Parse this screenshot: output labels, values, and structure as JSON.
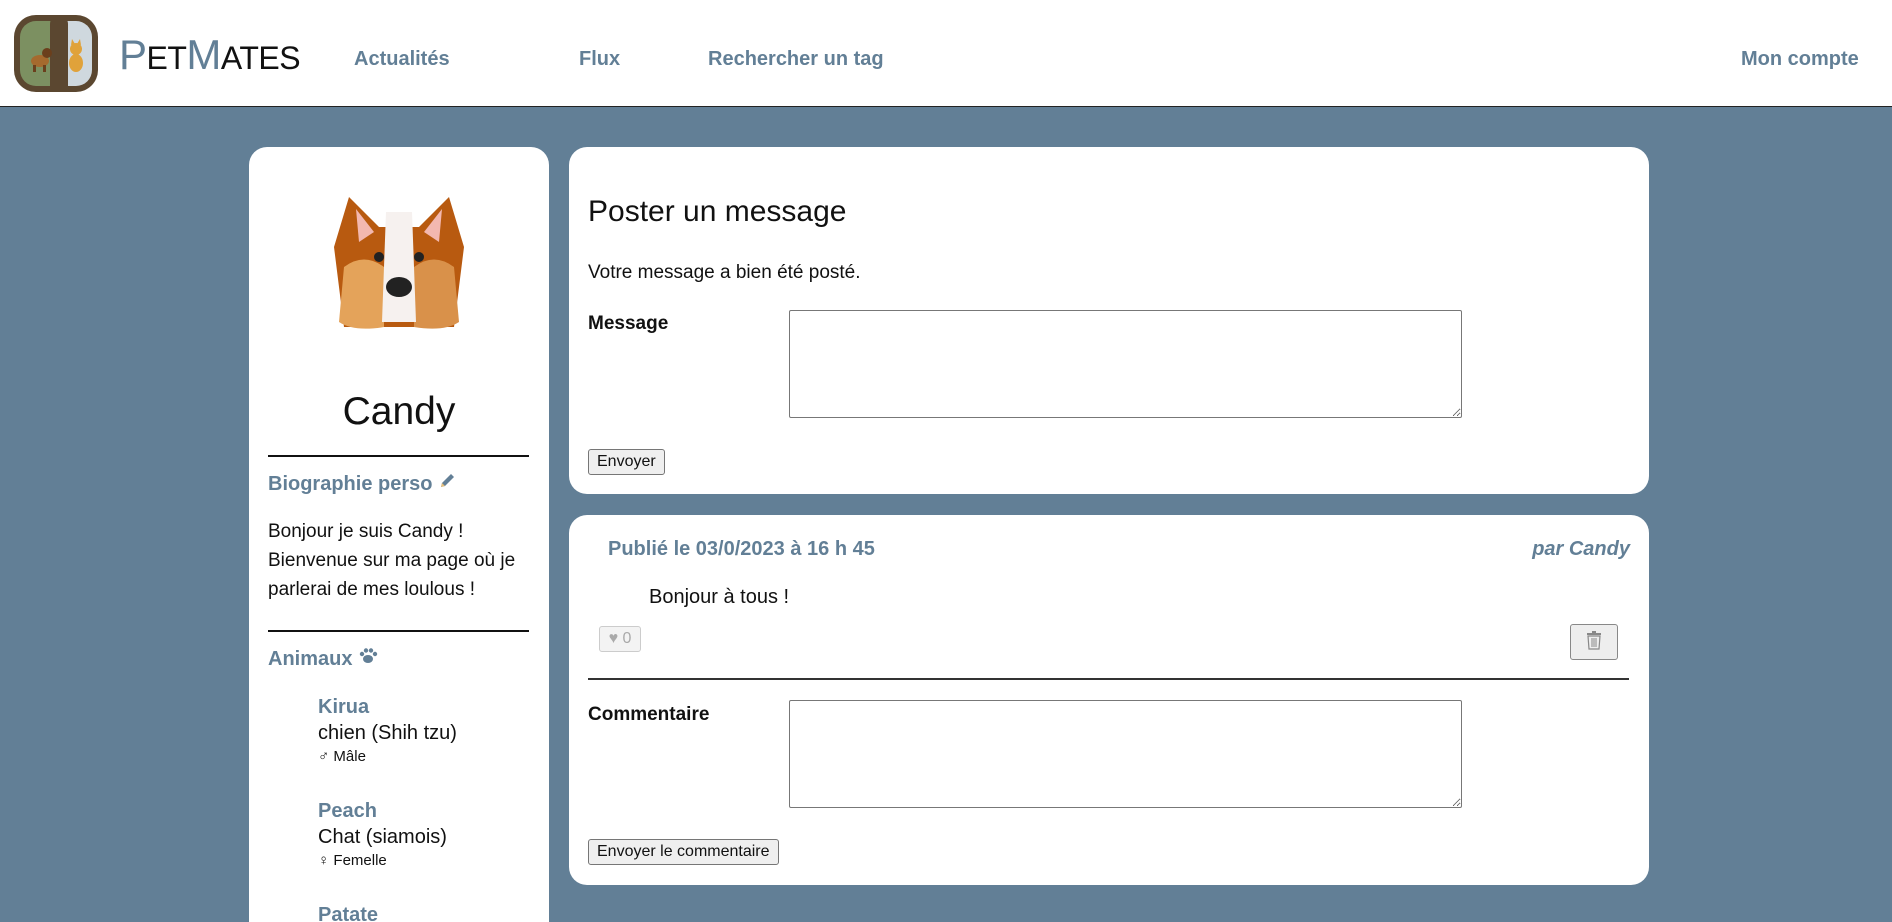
{
  "header": {
    "brand": {
      "p": "P",
      "et": "ET",
      "m": "M",
      "ates": "ATES"
    },
    "nav": [
      {
        "label": "Actualités"
      },
      {
        "label": "Flux"
      },
      {
        "label": "Rechercher un tag"
      }
    ],
    "account_label": "Mon compte"
  },
  "profile": {
    "name": "Candy",
    "bio_title": "Biographie perso",
    "bio_text": "Bonjour je suis Candy ! Bienvenue sur ma page où je parlerai de mes loulous !",
    "pets_title": "Animaux",
    "pets": [
      {
        "name": "Kirua",
        "species": "chien (Shih tzu)",
        "gender": "♂ Mâle"
      },
      {
        "name": "Peach",
        "species": "Chat (siamois)",
        "gender": "♀ Femelle"
      },
      {
        "name": "Patate"
      }
    ]
  },
  "post_form": {
    "title": "Poster un message",
    "status": "Votre message a bien été posté.",
    "message_label": "Message",
    "message_value": "",
    "submit_label": "Envoyer"
  },
  "post": {
    "date": "Publié le 03/0/2023 à 16 h 45",
    "author": "par Candy",
    "body": "Bonjour à tous !",
    "likes": "♥ 0",
    "comment_label": "Commentaire",
    "comment_value": "",
    "comment_submit_label": "Envoyer le commentaire"
  },
  "colors": {
    "accent": "#627f96",
    "background": "#627f96",
    "logo_frame": "#5b4730",
    "logo_green": "#7c9061"
  },
  "icons": {
    "edit": "pencil-icon",
    "pets": "paw-icon",
    "delete": "trash-icon",
    "like": "heart-icon"
  }
}
